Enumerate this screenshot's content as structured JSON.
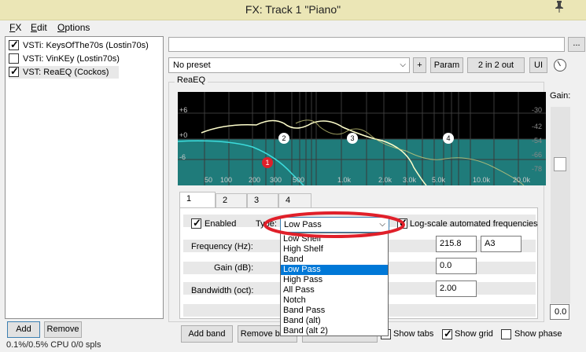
{
  "window": {
    "title": "FX: Track 1 \"Piano\"",
    "pin_icon": "pin-icon",
    "close_label": "✕"
  },
  "menu": [
    {
      "label": "FX",
      "hot": "F",
      "rest": "X"
    },
    {
      "label": "Edit",
      "hot": "E",
      "rest": "dit"
    },
    {
      "label": "Options",
      "hot": "O",
      "rest": "ptions"
    }
  ],
  "fx_chain": [
    {
      "label": "VSTi: KeysOfThe70s (Lostin70s)",
      "checked": true
    },
    {
      "label": "VSTi: VinKEy (Lostin70s)",
      "checked": false
    },
    {
      "label": "VST: ReaEQ (Cockos)",
      "checked": true
    }
  ],
  "left_buttons": {
    "add": "Add",
    "remove": "Remove"
  },
  "status": "0.1%/0.5% CPU 0/0 spls",
  "top_bar": {
    "search_button": "...",
    "preset": "No preset",
    "plus": "+",
    "param": "Param",
    "io": "2 in 2 out",
    "ui": "UI"
  },
  "plugin": {
    "name": "ReaEQ",
    "gain_label": "Gain:",
    "gain_value": "0.0",
    "graph": {
      "db_labels_left": [
        "+6",
        "+0",
        "-6"
      ],
      "db_labels_right": [
        "-30",
        "-42",
        "-54",
        "-66",
        "-78"
      ],
      "freq_labels": [
        "50",
        "100",
        "200",
        "300",
        "500",
        "1.0k",
        "2.0k",
        "3.0k",
        "5.0k",
        "10.0k",
        "20.0k"
      ],
      "band_markers": [
        "1",
        "2",
        "3",
        "4"
      ]
    },
    "tabs": [
      "1",
      "2",
      "3",
      "4"
    ],
    "band": {
      "enabled_label": "Enabled",
      "enabled": true,
      "type_label": "Type:",
      "type_value": "Low Pass",
      "logscale_label": "Log-scale automated frequencies",
      "logscale_checked": true,
      "freq_label": "Frequency (Hz):",
      "freq_value": "215.8",
      "note_value": "A3",
      "gain_label": "Gain (dB):",
      "gain_value": "0.0",
      "bw_label": "Bandwidth (oct):",
      "bw_value": "2.00"
    },
    "type_options": [
      "Low Shelf",
      "High Shelf",
      "Band",
      "Low Pass",
      "High Pass",
      "All Pass",
      "Notch",
      "Band Pass",
      "Band (alt)",
      "Band (alt 2)"
    ],
    "type_selected": "Low Pass",
    "bottom": {
      "add_band": "Add band",
      "remove_band": "Remove band",
      "reset": "Reset to defaults",
      "show_tabs": "Show tabs",
      "show_grid": "Show grid",
      "show_phase": "Show phase",
      "show_tabs_checked": false,
      "show_grid_checked": true,
      "show_phase_checked": false
    }
  },
  "colors": {
    "title_bar": "#ebe6b6",
    "eq_background": "#000000",
    "eq_fill": "#1f7b7a",
    "eq_curve": "#ffffcc",
    "lowpass_curve": "#3cdcdc",
    "selection": "#0078d7",
    "highlight_circle": "#e0202a"
  }
}
